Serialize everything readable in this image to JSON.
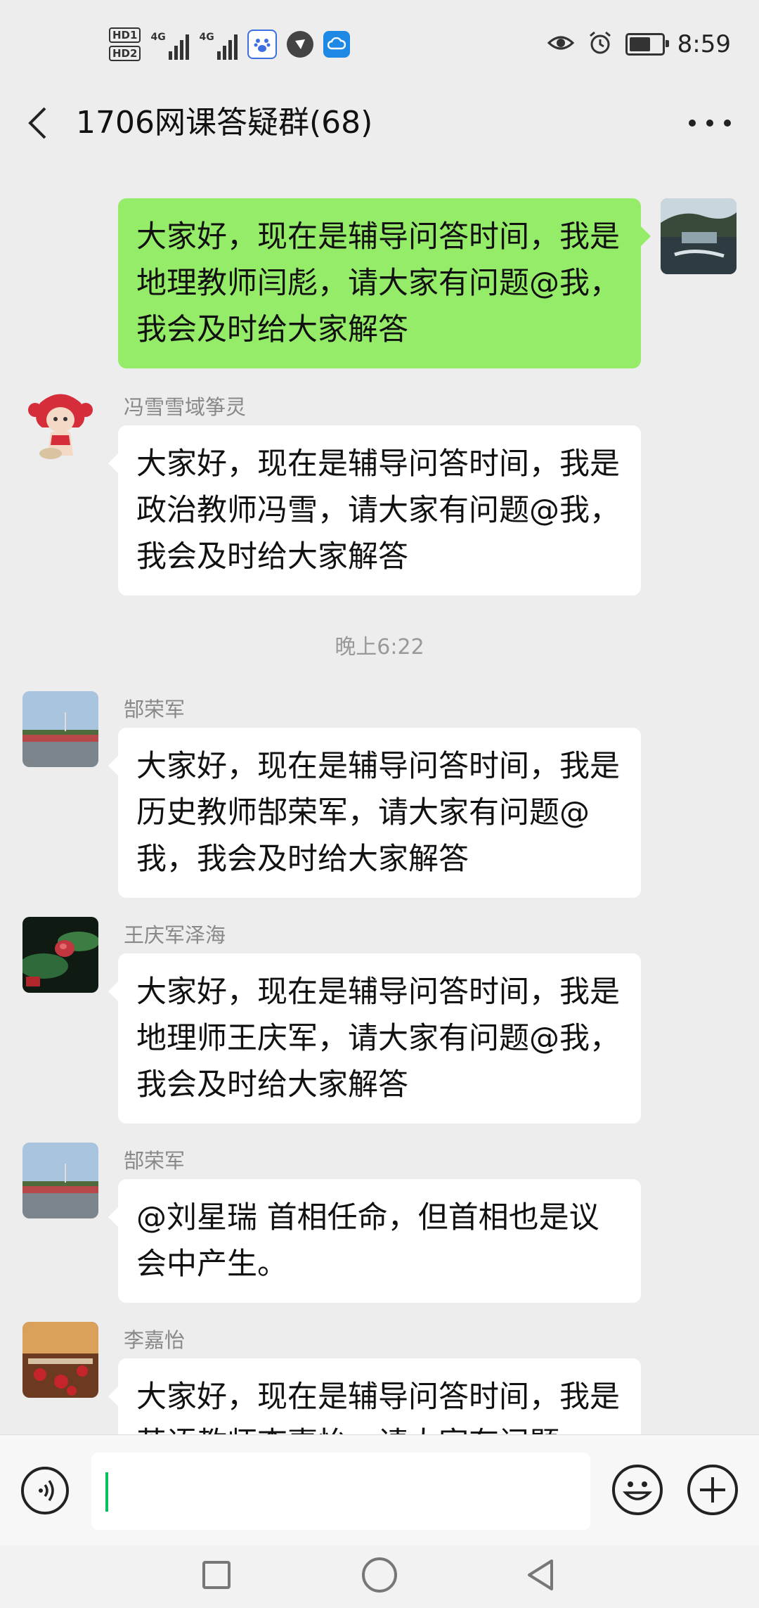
{
  "status_bar": {
    "hd1": "HD1",
    "hd2": "HD2",
    "network1": "4G",
    "network2": "4G",
    "time": "8:59",
    "battery_level": 0.75
  },
  "header": {
    "title": "1706网课答疑群(68)"
  },
  "messages": [
    {
      "sender": "",
      "text": "大家好，现在是辅导问答时间，我是地理教师闫彪，请大家有问题@我，我会及时给大家解答"
    },
    {
      "sender": "冯雪雪域筝灵",
      "text": "大家好，现在是辅导问答时间，我是政治教师冯雪，请大家有问题@我，我会及时给大家解答"
    },
    {
      "sender": "郜荣军",
      "text": "大家好，现在是辅导问答时间，我是历史教师郜荣军，请大家有问题@我，我会及时给大家解答"
    },
    {
      "sender": "王庆军泽海",
      "text": "大家好，现在是辅导问答时间，我是地理师王庆军，请大家有问题@我，我会及时给大家解答"
    },
    {
      "sender": "郜荣军",
      "text": "@刘星瑞  首相任命，但首相也是议会中产生。"
    },
    {
      "sender": "李嘉怡",
      "text": "大家好，现在是辅导问答时间，我是英语教师李嘉怡，请大家有问题"
    }
  ],
  "timestamp": "晚上6:22",
  "input": {
    "value": ""
  },
  "colors": {
    "chat_bg": "#ededed",
    "mine_bubble": "#95ec69",
    "other_bubble": "#ffffff",
    "caret": "#07c160"
  }
}
